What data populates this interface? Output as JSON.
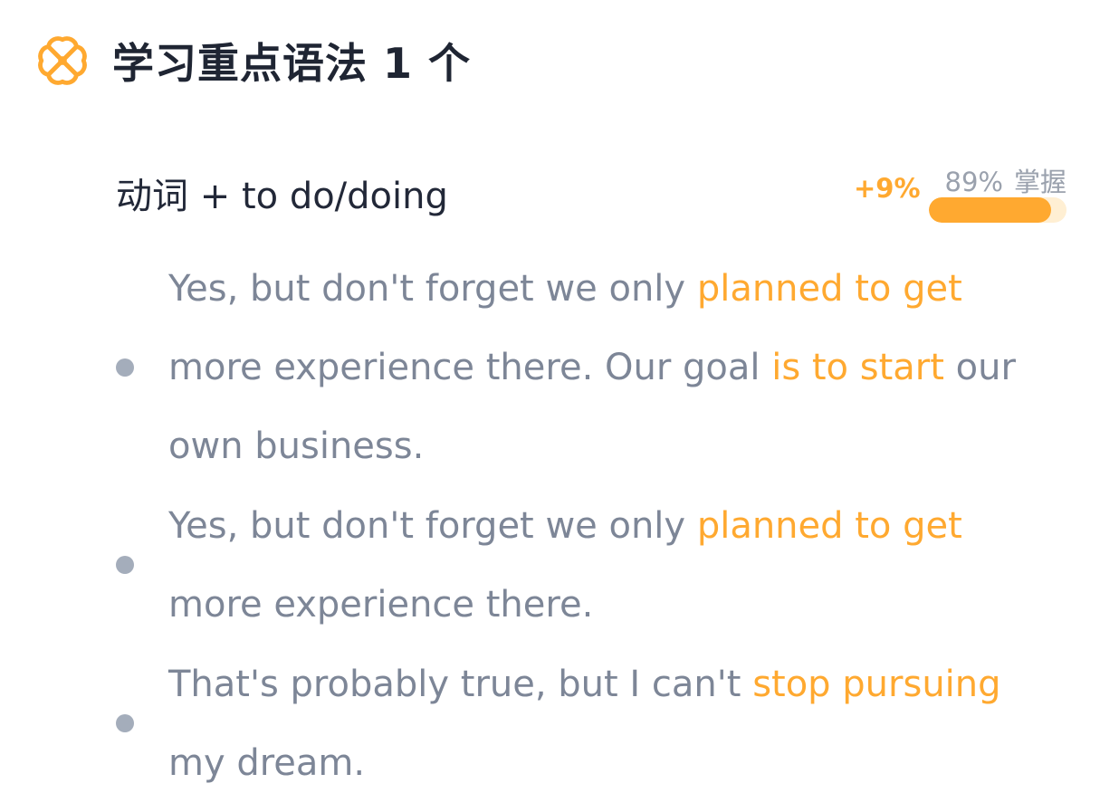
{
  "header": {
    "icon": "four-petal-flower-icon",
    "title": "学习重点语法 1 个"
  },
  "grammar": {
    "title": "动词 + to do/doing",
    "mastery_delta": "+9%",
    "mastery_percent": "89%",
    "mastery_label": "掌握",
    "mastery_fraction": 0.89
  },
  "examples": [
    {
      "segments": [
        {
          "text": "Yes, but don't forget we only ",
          "highlight": false
        },
        {
          "text": "planned to get",
          "highlight": true
        },
        {
          "text": " more experience there. Our goal ",
          "highlight": false
        },
        {
          "text": "is to start",
          "highlight": true
        },
        {
          "text": " our own business.",
          "highlight": false
        }
      ]
    },
    {
      "segments": [
        {
          "text": "Yes, but don't forget we only ",
          "highlight": false
        },
        {
          "text": "planned to get",
          "highlight": true
        },
        {
          "text": " more experience there.",
          "highlight": false
        }
      ]
    },
    {
      "segments": [
        {
          "text": "That's probably true, but I can't ",
          "highlight": false
        },
        {
          "text": "stop pursuing",
          "highlight": true
        },
        {
          "text": " my dream.",
          "highlight": false
        }
      ]
    }
  ],
  "colors": {
    "accent": "#ffa930",
    "title_text": "#1f2533",
    "body_text": "#7d8697",
    "bullet": "#a4adbb",
    "bar_track": "#ffefd3"
  }
}
